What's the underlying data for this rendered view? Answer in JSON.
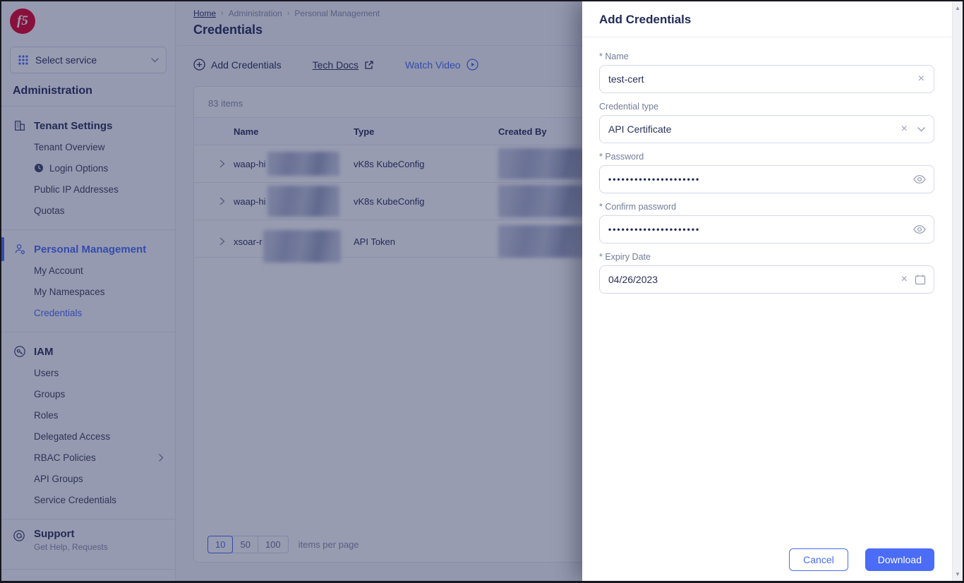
{
  "colors": {
    "accent": "#4a6cf7",
    "brand_red": "#e4002b",
    "navy_text": "#232b58",
    "label_gray": "#737c99",
    "backdrop": "rgba(27,35,82,0.45)"
  },
  "sidebar": {
    "service_selector": {
      "label": "Select service"
    },
    "title": "Administration",
    "groups": [
      {
        "label": "Tenant Settings",
        "items": [
          "Tenant Overview",
          "Login Options",
          "Public IP Addresses",
          "Quotas"
        ]
      },
      {
        "label": "Personal Management",
        "items": [
          "My Account",
          "My Namespaces",
          "Credentials"
        ]
      },
      {
        "label": "IAM",
        "items": [
          "Users",
          "Groups",
          "Roles",
          "Delegated Access",
          "RBAC Policies",
          "API Groups",
          "Service Credentials"
        ]
      }
    ],
    "support": {
      "label": "Support",
      "subtitle": "Get Help, Requests"
    }
  },
  "breadcrumb": {
    "items": [
      "Home",
      "Administration",
      "Personal Management"
    ]
  },
  "page": {
    "title": "Credentials"
  },
  "toolbar": {
    "add_credentials": "Add Credentials",
    "tech_docs": "Tech Docs",
    "watch_video": "Watch Video"
  },
  "table": {
    "items_count": "83 items",
    "columns": [
      "Name",
      "Type",
      "Created By"
    ],
    "rows": [
      {
        "name": "waap-hi",
        "type": "vK8s KubeConfig",
        "name_redacted": true,
        "created_by_redacted": true
      },
      {
        "name": "waap-hi",
        "type": "vK8s KubeConfig",
        "name_redacted": true,
        "created_by_redacted": true
      },
      {
        "name": "xsoar-r",
        "type": "API Token",
        "name_redacted": true,
        "created_by_redacted": true
      }
    ],
    "pagination": {
      "sizes": [
        "10",
        "50",
        "100"
      ],
      "selected": "10",
      "label": "items per page"
    }
  },
  "drawer": {
    "title": "Add Credentials",
    "fields": {
      "name": {
        "label": "* Name",
        "value": "test-cert"
      },
      "credential_type": {
        "label": "Credential type",
        "value": "API Certificate"
      },
      "password": {
        "label": "* Password",
        "value": "•••••••••••••••••••••"
      },
      "confirm_password": {
        "label": "* Confirm password",
        "value": "•••••••••••••••••••••"
      },
      "expiry_date": {
        "label": "* Expiry Date",
        "value": "04/26/2023"
      }
    },
    "buttons": {
      "cancel": "Cancel",
      "download": "Download"
    }
  }
}
